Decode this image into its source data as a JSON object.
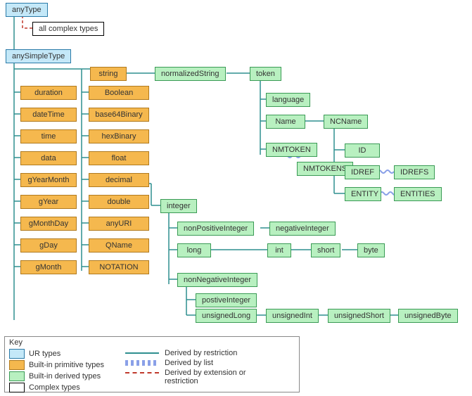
{
  "nodes": {
    "anyType": "anyType",
    "allComplex": "all complex types",
    "anySimpleType": "anySimpleType",
    "string": "string",
    "normalizedString": "normalizedString",
    "token": "token",
    "language": "language",
    "Name": "Name",
    "NCName": "NCName",
    "NMTOKEN": "NMTOKEN",
    "NMTOKENS": "NMTOKENS",
    "ID": "ID",
    "IDREF": "IDREF",
    "IDREFS": "IDREFS",
    "ENTITY": "ENTITY",
    "ENTITIES": "ENTITIES",
    "duration": "duration",
    "dateTime": "dateTime",
    "time": "time",
    "data": "data",
    "gYearMonth": "gYearMonth",
    "gYear": "gYear",
    "gMonthDay": "gMonthDay",
    "gDay": "gDay",
    "gMonth": "gMonth",
    "Boolean": "Boolean",
    "base64Binary": "base64Binary",
    "hexBinary": "hexBinary",
    "float": "float",
    "decimal": "decimal",
    "double": "double",
    "anyURI": "anyURI",
    "QName": "QName",
    "NOTATION": "NOTATION",
    "integer": "integer",
    "nonPositiveInteger": "nonPositiveInteger",
    "negativeInteger": "negativeInteger",
    "long": "long",
    "int": "int",
    "short": "short",
    "byte": "byte",
    "nonNegativeInteger": "nonNegativeInteger",
    "positiveInteger": "postiveInteger",
    "unsignedLong": "unsignedLong",
    "unsignedInt": "unsignedInt",
    "unsignedShort": "unsignedShort",
    "unsignedByte": "unsignedByte"
  },
  "key": {
    "title": "Key",
    "ur": "UR types",
    "primitive": "Built-in primitive types",
    "derived": "Built-in derived types",
    "complex": "Complex types",
    "restriction": "Derived by restriction",
    "list": "Derived by list",
    "extOrRes": "Derived by extension or restriction"
  }
}
